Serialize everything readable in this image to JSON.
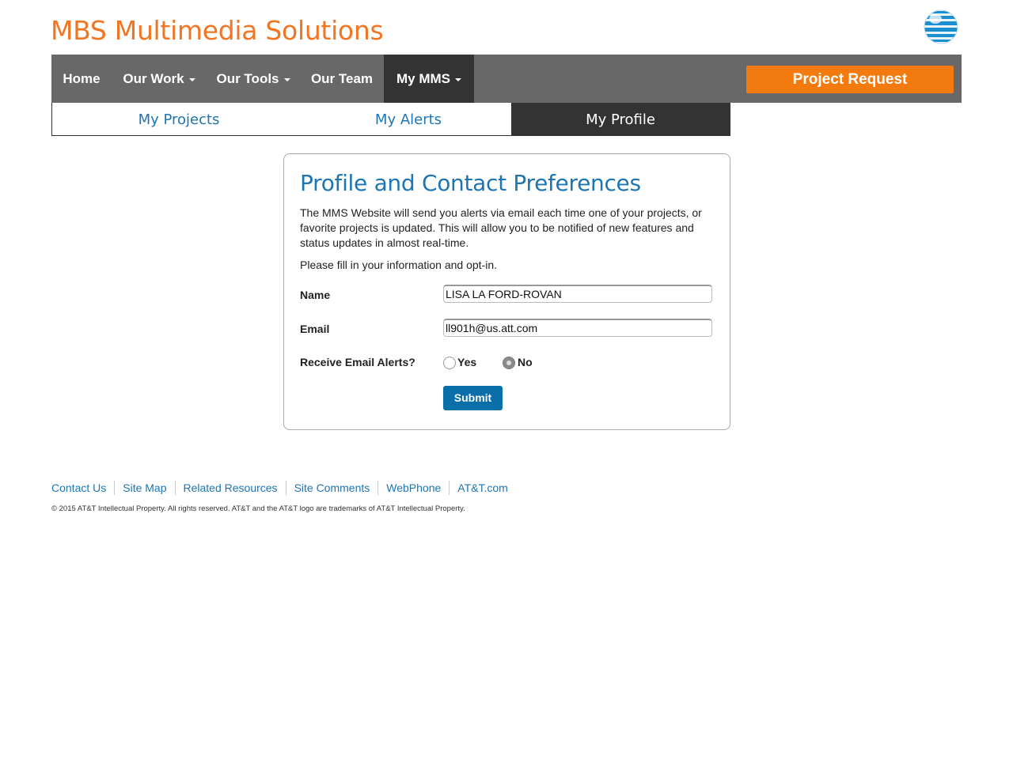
{
  "header": {
    "site_title": "MBS Multimedia Solutions",
    "logo_icon": "att-globe-icon",
    "brand_color": "#f07623"
  },
  "nav": {
    "items": [
      {
        "label": "Home",
        "has_caret": false
      },
      {
        "label": "Our Work",
        "has_caret": true
      },
      {
        "label": "Our Tools",
        "has_caret": true
      },
      {
        "label": "Our Team",
        "has_caret": false
      },
      {
        "label": "My MMS",
        "has_caret": true,
        "active": true
      }
    ],
    "cta_label": "Project Request",
    "cta_color": "#f27a0f"
  },
  "subnav": {
    "items": [
      {
        "label": "My Projects"
      },
      {
        "label": "My Alerts"
      },
      {
        "label": "My Profile",
        "active": true
      }
    ]
  },
  "profile": {
    "title": "Profile and Contact Preferences",
    "description": "The MMS Website will send you alerts via email each time one of your projects, or favorite projects is updated. This will allow you to be notified of new features and status updates in almost real-time.",
    "prompt": "Please fill in your information and opt-in.",
    "name_label": "Name",
    "name_value": "LISA LA FORD-ROVAN",
    "email_label": "Email",
    "email_value": "ll901h@us.att.com",
    "alerts_label": "Receive Email Alerts?",
    "alerts_options": [
      "Yes",
      "No"
    ],
    "alerts_selected": "No",
    "submit_label": "Submit",
    "accent_color": "#1d75b3"
  },
  "footer": {
    "links": [
      "Contact Us",
      "Site Map",
      "Related Resources",
      "Site Comments",
      "WebPhone",
      "AT&T.com"
    ],
    "copyright": "© 2015 AT&T Intellectual Property. All rights reserved. AT&T and the AT&T logo are trademarks of AT&T Intellectual Property."
  }
}
